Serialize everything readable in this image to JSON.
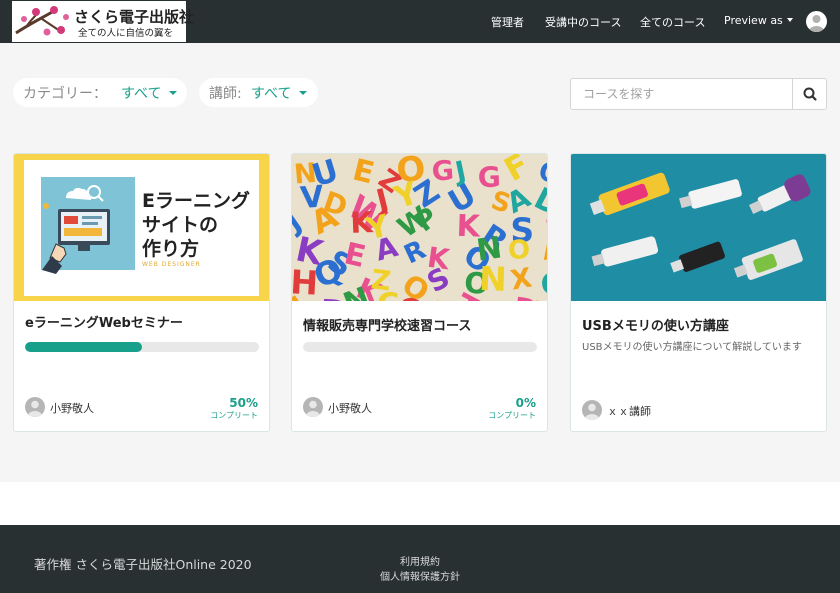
{
  "header": {
    "logo_title": "さくら電子出版社",
    "logo_tagline": "全ての人に自信の翼を",
    "nav": [
      "管理者",
      "受講中のコース",
      "全てのコース"
    ],
    "preview_label": "Preview as",
    "preview_icon": "caret-down-icon",
    "account_icon": "user-avatar-icon"
  },
  "filters": {
    "category_label": "カテゴリー：",
    "category_value": "すべて",
    "instructor_label": "講師:",
    "instructor_value": "すべて"
  },
  "search": {
    "placeholder": "コースを探す",
    "value": "",
    "icon": "search-icon"
  },
  "courses": [
    {
      "title": "eラーニングWebセミナー",
      "image_heading": "Eラーニング\nサイトの\n作り方",
      "image_caption": "WEB DESIGNER",
      "progress": 50,
      "progress_label": "50%",
      "complete_label": "コンプリート",
      "author": "小野敬人"
    },
    {
      "title": "情報販売専門学校速習コース",
      "progress": 0,
      "progress_label": "0%",
      "complete_label": "コンプリート",
      "author": "小野敬人"
    },
    {
      "title": "USBメモリの使い方講座",
      "description": "USBメモリの使い方講座について解説しています",
      "author": "ｘｘ講師"
    }
  ],
  "footer": {
    "copyright": "著作権 さくら電子出版社Online 2020",
    "links": [
      "利用規約",
      "個人情報保護方針"
    ]
  },
  "colors": {
    "header_bg": "#283032",
    "accent": "#18a08a",
    "page_bg": "#f5f5f5"
  }
}
